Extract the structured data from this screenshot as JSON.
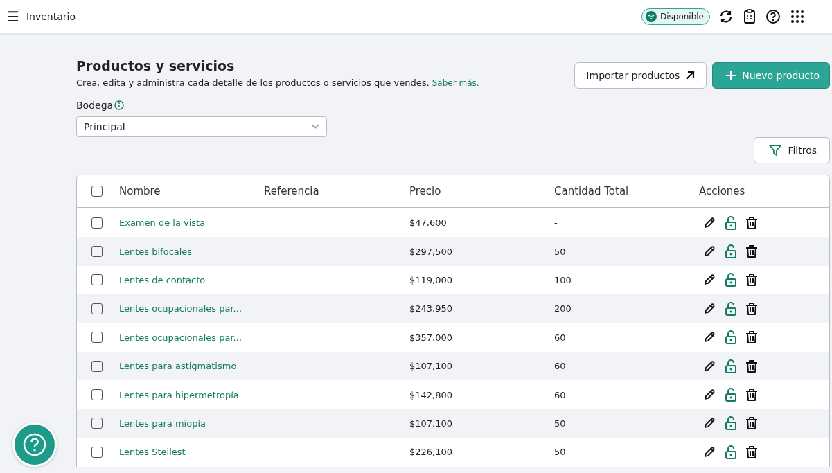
{
  "app_bar": {
    "menu_icon": "☰",
    "title": "Inventario",
    "status": {
      "label": "Disponible"
    }
  },
  "header": {
    "title": "Productos y servicios",
    "description": "Crea, edita y administra cada detalle de los productos o servicios que vendes.",
    "link": "Saber más.",
    "buttons": [
      {
        "kind": "outline",
        "label": "Importar productos"
      },
      {
        "kind": "primary",
        "label": "Nuevo producto"
      }
    ]
  },
  "warehouse": {
    "label": "Bodega",
    "value": "Principal"
  },
  "filters_button": "Filtros",
  "table": {
    "select_all_checked": false,
    "columns": [
      "Nombre",
      "Referencia",
      "Precio",
      "Cantidad Total",
      "Acciones"
    ],
    "rows": [
      {
        "name": "Examen de la vista",
        "reference": "",
        "price": "$47,600",
        "quantity": "-",
        "checked": false
      },
      {
        "name": "Lentes bifocales",
        "reference": "",
        "price": "$297,500",
        "quantity": "50",
        "checked": false
      },
      {
        "name": "Lentes de contacto",
        "reference": "",
        "price": "$119,000",
        "quantity": "100",
        "checked": false
      },
      {
        "name": "Lentes ocupacionales par...",
        "reference": "",
        "price": "$243,950",
        "quantity": "200",
        "checked": false
      },
      {
        "name": "Lentes ocupacionales par...",
        "reference": "",
        "price": "$357,000",
        "quantity": "60",
        "checked": false
      },
      {
        "name": "Lentes para astigmatismo",
        "reference": "",
        "price": "$107,100",
        "quantity": "60",
        "checked": false
      },
      {
        "name": "Lentes para hipermetropía",
        "reference": "",
        "price": "$142,800",
        "quantity": "60",
        "checked": false
      },
      {
        "name": "Lentes para miopía",
        "reference": "",
        "price": "$107,100",
        "quantity": "50",
        "checked": false
      },
      {
        "name": "Lentes Stellest",
        "reference": "",
        "price": "$226,100",
        "quantity": "50",
        "checked": false
      }
    ]
  }
}
